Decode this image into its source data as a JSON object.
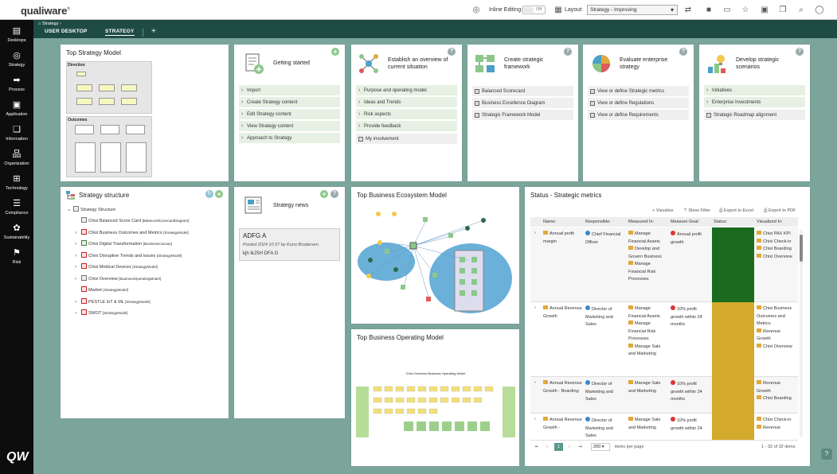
{
  "app": {
    "logo": "qualiware",
    "sidebar_logo": "QW"
  },
  "topbar": {
    "inline_editing_label": "Inline Editing:",
    "inline_editing_value": "Off",
    "layout_label": "Layout:",
    "layout_value": "Strategy - Improving"
  },
  "sidebar": {
    "items": [
      {
        "label": "Desktops",
        "icon": "desktop-icon"
      },
      {
        "label": "Strategy",
        "icon": "target-icon"
      },
      {
        "label": "Process",
        "icon": "process-icon"
      },
      {
        "label": "Application",
        "icon": "application-icon"
      },
      {
        "label": "Information",
        "icon": "document-icon"
      },
      {
        "label": "Organization",
        "icon": "org-chart-icon"
      },
      {
        "label": "Technology",
        "icon": "chip-icon"
      },
      {
        "label": "Compliance",
        "icon": "checklist-icon"
      },
      {
        "label": "Sustainability",
        "icon": "leaf-icon"
      },
      {
        "label": "Risk",
        "icon": "flag-icon"
      }
    ]
  },
  "breadcrumb": {
    "item": "Strategy"
  },
  "tabs": [
    {
      "label": "USER DESKTOP"
    },
    {
      "label": "STRATEGY"
    }
  ],
  "cards": {
    "top_strategy_model": {
      "title": "Top Strategy Model",
      "direction_label": "Direction",
      "outcomes_label": "Outcomes"
    },
    "getting_started": {
      "title": "Getting started",
      "items": [
        "Import",
        "Create Strategy content",
        "Edit Strategy content",
        "View Strategy content",
        "Approach to Strategy"
      ]
    },
    "establish_overview": {
      "title": "Establish an overview of current situation",
      "items": [
        "Purpose and operating model",
        "Ideas and Trends",
        "Risk aspects",
        "Provide feedback"
      ],
      "extra": "My involvement"
    },
    "create_framework": {
      "title": "Create strategic framework",
      "items": [
        "Balanced Scorecard",
        "Business Excellence Diagram",
        "Strategic Framework Model"
      ]
    },
    "evaluate_architecture": {
      "title": "Evaluate enterprise strategy",
      "items": [
        "View or define Strategic metrics",
        "View or define Regulations",
        "View or define Requirements"
      ]
    },
    "develop_scenarios": {
      "title": "Develop strategic scenarios",
      "items": [
        "Initiatives",
        "Enterprise Investments"
      ],
      "extra": "Strategic Roadmap alignment"
    },
    "strategy_structure": {
      "title": "Strategy structure",
      "root": "Strategy Structure",
      "items": [
        {
          "name": "Chixi Balanced Score Card",
          "type": "[BalancedScorecardDiagram]",
          "icon": "grey",
          "expand": ""
        },
        {
          "name": "Chixi Business Outcomes and Metrics",
          "type": "[StrategyModel]",
          "icon": "red",
          "expand": "›"
        },
        {
          "name": "Chixi Digital Transformation",
          "type": "[BusinessCanvas]",
          "icon": "grn",
          "expand": "›"
        },
        {
          "name": "Chixi Disruptive Trends and issues",
          "type": "[StrategyModel]",
          "icon": "red",
          "expand": "›"
        },
        {
          "name": "Chixi Medical Devices",
          "type": "[StrategyModel]",
          "icon": "red",
          "expand": "›"
        },
        {
          "name": "Chixi Overview",
          "type": "[BusinessOperatingModel]",
          "icon": "grey",
          "expand": "›"
        },
        {
          "name": "Market",
          "type": "[StrategyModel]",
          "icon": "red",
          "expand": ""
        },
        {
          "name": "PESTLE IoT & ML",
          "type": "[StrategyModel]",
          "icon": "red",
          "expand": "›"
        },
        {
          "name": "SWOT",
          "type": "[StrategyModel]",
          "icon": "red",
          "expand": "›"
        }
      ]
    },
    "strategy_news": {
      "title": "Strategy news",
      "headline": "ADFG A",
      "posted": "Posted 2024 10 07 by Kuno Brodersen",
      "body": "kjh lkJSH DFA G"
    },
    "ecosystem": {
      "title": "Top Business Ecosystem Model"
    },
    "operating_model": {
      "title": "Top Business Operating Model",
      "diagram_title": "Chixi Overview Business Operating Model"
    },
    "status_metrics": {
      "title": "Status - Strategic metrics",
      "actions": [
        "Visualize",
        "Show Filter",
        "Export to Excel",
        "Export to PDF"
      ],
      "columns": [
        "Name:",
        "Responsible:",
        "Measured In:",
        "Measure Goal:",
        "Status:",
        "Visualized In:"
      ],
      "rows": [
        {
          "name": "Annual profit margin",
          "responsible": "Chief Financial Officer",
          "measured": [
            "Manage Financial Assets",
            "Develop and Govern Business",
            "Manage Financial Risk Processes"
          ],
          "goal": "Annual profit growth",
          "status": "#1b6b1f",
          "visualized": [
            "Chixi PAX KPI",
            "Chixi Check-in",
            "Chixi Boarding",
            "Chixi Overview"
          ]
        },
        {
          "name": "Annual Revenue Growth",
          "responsible": "Director of Marketing and Sales",
          "measured": [
            "Manage Financial Assets",
            "Manage Financial Risk Processes",
            "Manage Sale and Marketing"
          ],
          "goal": "10% profit growth within 24 months",
          "status": "#d4aa2c",
          "visualized": [
            "Chixi Business Outcomes and Metrics",
            "Revenue Growth",
            "Chixi Overview"
          ]
        },
        {
          "name": "Annual Revenue Growth - Boarding",
          "responsible": "Director of Marketing and Sales",
          "measured": [
            "Manage Sale and Marketing"
          ],
          "goal": "10% profit growth within 24 months",
          "status": "#d4aa2c",
          "visualized": [
            "Revenue Growth",
            "Chixi Boarding"
          ]
        },
        {
          "name": "Annual Revenue Growth -",
          "responsible": "Director of Marketing and Sales",
          "measured": [
            "Manage Sale and Marketing"
          ],
          "goal": "10% profit growth within 24",
          "status": "#d4aa2c",
          "visualized": [
            "Chixi Check-in",
            "Revenue"
          ]
        }
      ],
      "page": "1",
      "page_size": "200",
      "items_per_page": "items per page",
      "count": "1 - 32 of 32 items"
    }
  },
  "colors": {
    "accent": "#1f4b45",
    "background": "#7ba59b",
    "sidebar": "#0d0d0d"
  }
}
